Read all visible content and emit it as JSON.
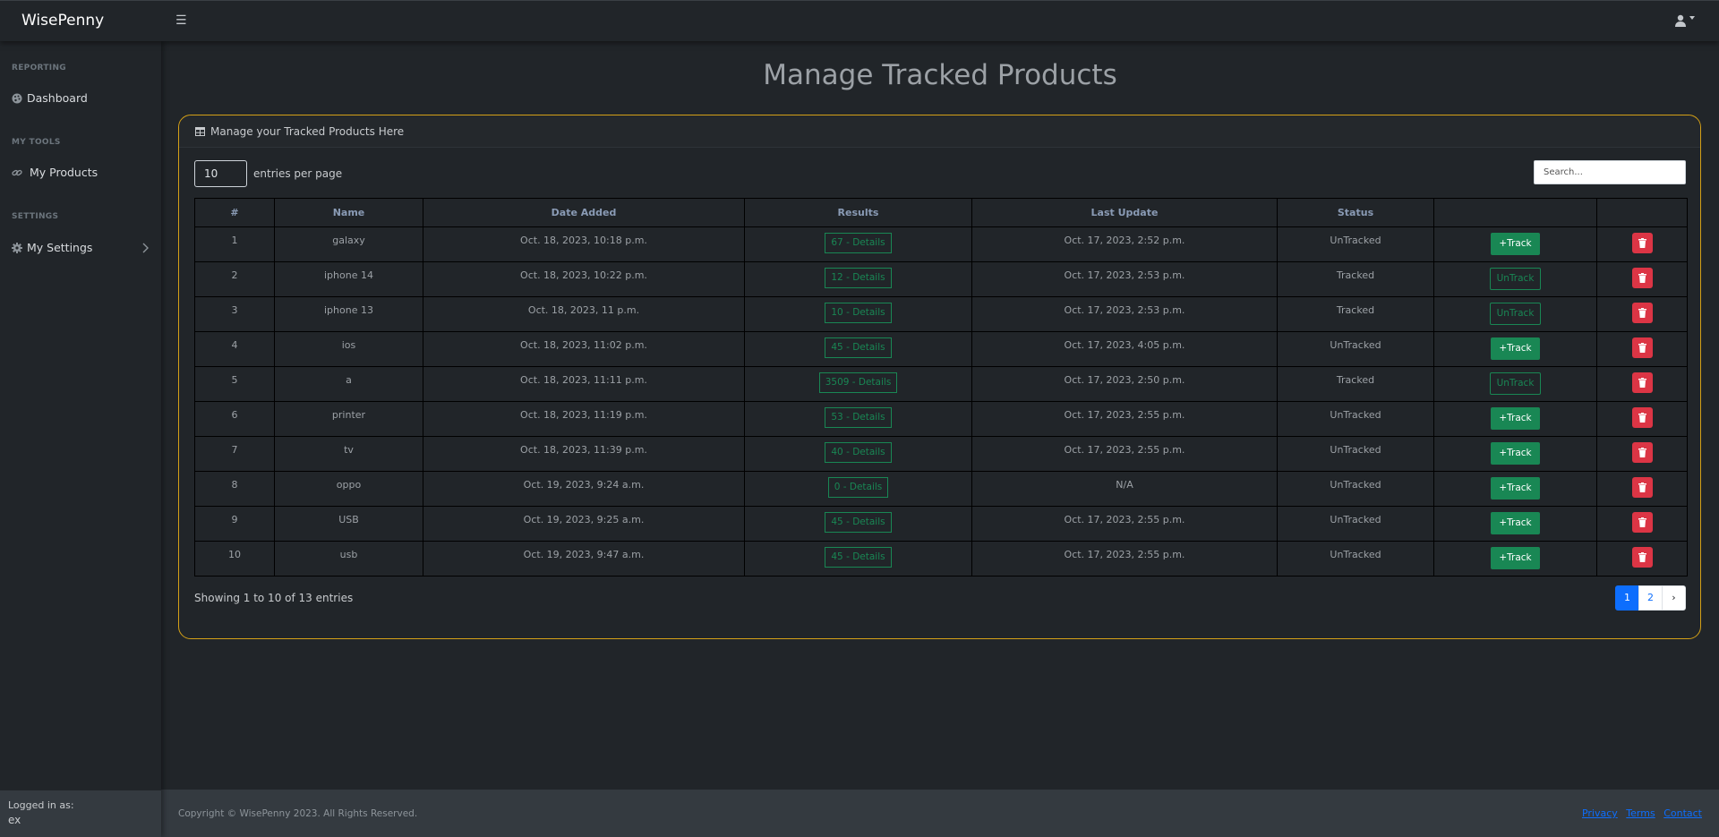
{
  "app": {
    "brand": "WisePenny"
  },
  "sidebar": {
    "sections": [
      {
        "heading": "REPORTING",
        "item": {
          "label": "Dashboard",
          "icon": "palette-icon"
        }
      },
      {
        "heading": "MY TOOLS",
        "item": {
          "label": "My Products",
          "icon": "link-icon"
        }
      },
      {
        "heading": "SETTINGS",
        "item": {
          "label": "My Settings",
          "icon": "gear-icon"
        }
      }
    ],
    "footer": {
      "logged_in_label": "Logged in as:",
      "username": "ex"
    }
  },
  "page": {
    "title": "Manage Tracked Products"
  },
  "card": {
    "header": "Manage your Tracked Products Here",
    "per_page_value": "10",
    "per_page_label": "entries per page",
    "search_placeholder": "Search..."
  },
  "table": {
    "columns": [
      "#",
      "Name",
      "Date Added",
      "Results",
      "Last Update",
      "Status",
      "",
      ""
    ],
    "rows": [
      {
        "num": "1",
        "name": "galaxy",
        "date_added": "Oct. 18, 2023, 10:18 p.m.",
        "results": "67 - Details",
        "last_update": "Oct. 17, 2023, 2:52 p.m.",
        "status": "UnTracked",
        "action": "+Track"
      },
      {
        "num": "2",
        "name": "iphone 14",
        "date_added": "Oct. 18, 2023, 10:22 p.m.",
        "results": "12 - Details",
        "last_update": "Oct. 17, 2023, 2:53 p.m.",
        "status": "Tracked",
        "action": "UnTrack"
      },
      {
        "num": "3",
        "name": "iphone 13",
        "date_added": "Oct. 18, 2023, 11 p.m.",
        "results": "10 - Details",
        "last_update": "Oct. 17, 2023, 2:53 p.m.",
        "status": "Tracked",
        "action": "UnTrack"
      },
      {
        "num": "4",
        "name": "ios",
        "date_added": "Oct. 18, 2023, 11:02 p.m.",
        "results": "45 - Details",
        "last_update": "Oct. 17, 2023, 4:05 p.m.",
        "status": "UnTracked",
        "action": "+Track"
      },
      {
        "num": "5",
        "name": "a",
        "date_added": "Oct. 18, 2023, 11:11 p.m.",
        "results": "3509 - Details",
        "last_update": "Oct. 17, 2023, 2:50 p.m.",
        "status": "Tracked",
        "action": "UnTrack"
      },
      {
        "num": "6",
        "name": "printer",
        "date_added": "Oct. 18, 2023, 11:19 p.m.",
        "results": "53 - Details",
        "last_update": "Oct. 17, 2023, 2:55 p.m.",
        "status": "UnTracked",
        "action": "+Track"
      },
      {
        "num": "7",
        "name": "tv",
        "date_added": "Oct. 18, 2023, 11:39 p.m.",
        "results": "40 - Details",
        "last_update": "Oct. 17, 2023, 2:55 p.m.",
        "status": "UnTracked",
        "action": "+Track"
      },
      {
        "num": "8",
        "name": "oppo",
        "date_added": "Oct. 19, 2023, 9:24 a.m.",
        "results": "0 - Details",
        "last_update": "N/A",
        "status": "UnTracked",
        "action": "+Track"
      },
      {
        "num": "9",
        "name": "USB",
        "date_added": "Oct. 19, 2023, 9:25 a.m.",
        "results": "45 - Details",
        "last_update": "Oct. 17, 2023, 2:55 p.m.",
        "status": "UnTracked",
        "action": "+Track"
      },
      {
        "num": "10",
        "name": "usb",
        "date_added": "Oct. 19, 2023, 9:47 a.m.",
        "results": "45 - Details",
        "last_update": "Oct. 17, 2023, 2:55 p.m.",
        "status": "UnTracked",
        "action": "+Track"
      }
    ]
  },
  "pagination": {
    "info": "Showing 1 to 10 of 13 entries",
    "pages": [
      "1",
      "2"
    ],
    "active_page": "1",
    "next": "›"
  },
  "footer": {
    "copyright": "Copyright © WisePenny 2023. All Rights Reserved.",
    "links": [
      "Privacy",
      "Terms",
      "Contact"
    ]
  },
  "colors": {
    "accent_border": "#d4a017",
    "success": "#198754",
    "danger": "#dc3545",
    "primary": "#0d6efd"
  }
}
